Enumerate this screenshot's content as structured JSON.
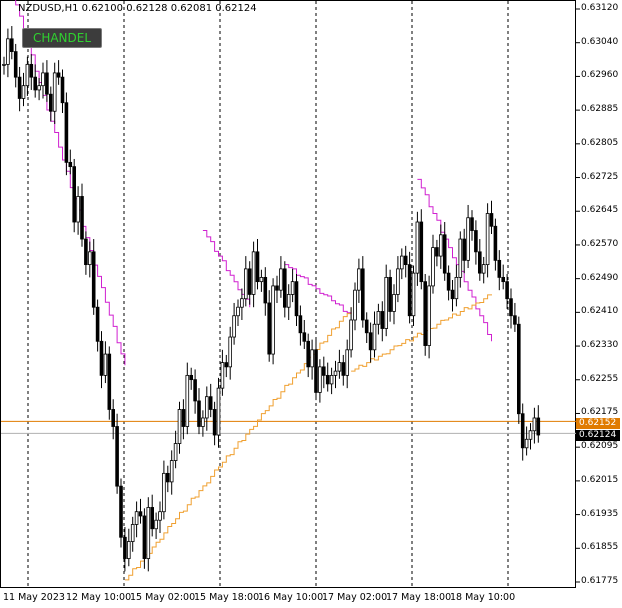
{
  "header": {
    "symbol": "NZDUSD,H1",
    "quote": "0.62100 0.62128 0.62081 0.62124"
  },
  "indicator_button": {
    "label": "CHANDEL",
    "text_color": "#2fd12f"
  },
  "colors": {
    "candle": "#000000",
    "stop_upper": "#d020d0",
    "stop_lower": "#f0a030",
    "line_orange": "#e07b00",
    "line_grey": "#b0b0b0"
  },
  "price_tags": {
    "orange": "0.62152",
    "current": "0.62124"
  },
  "y_axis": {
    "ticks": [
      "0.63120",
      "0.63040",
      "0.62960",
      "0.62885",
      "0.62805",
      "0.62725",
      "0.62645",
      "0.62570",
      "0.62490",
      "0.62410",
      "0.62330",
      "0.62255",
      "0.62175",
      "0.62095",
      "0.62015",
      "0.61935",
      "0.61855",
      "0.61775"
    ]
  },
  "x_axis": {
    "labels": [
      "11 May 2023",
      "12 May 10:00",
      "15 May 02:00",
      "15 May 18:00",
      "16 May 10:00",
      "17 May 02:00",
      "17 May 18:00",
      "18 May 10:00"
    ]
  },
  "chart_data": {
    "type": "candlestick",
    "title": "NZDUSD,H1",
    "ylim": [
      0.61775,
      0.6312
    ],
    "horizontal_lines": [
      {
        "value": 0.62152,
        "color": "#e07b00"
      },
      {
        "value": 0.62124,
        "color": "#b0b0b0"
      }
    ],
    "closes": [
      0.6299,
      0.6305,
      0.6302,
      0.6296,
      0.6291,
      0.6294,
      0.6299,
      0.6296,
      0.6293,
      0.6294,
      0.6297,
      0.6292,
      0.6288,
      0.6297,
      0.6296,
      0.629,
      0.6276,
      0.6275,
      0.6262,
      0.6268,
      0.6258,
      0.6252,
      0.6255,
      0.6242,
      0.6234,
      0.6226,
      0.6231,
      0.6218,
      0.6214,
      0.62,
      0.6188,
      0.6183,
      0.6187,
      0.6191,
      0.6194,
      0.6193,
      0.6183,
      0.6195,
      0.619,
      0.6192,
      0.6194,
      0.6203,
      0.6201,
      0.6206,
      0.621,
      0.6218,
      0.6214,
      0.6226,
      0.6225,
      0.622,
      0.6214,
      0.6216,
      0.6221,
      0.6218,
      0.6212,
      0.6223,
      0.6229,
      0.6228,
      0.6235,
      0.624,
      0.6242,
      0.6244,
      0.6251,
      0.6245,
      0.6255,
      0.6248,
      0.6249,
      0.6243,
      0.6231,
      0.6247,
      0.6246,
      0.6251,
      0.6242,
      0.6245,
      0.6248,
      0.624,
      0.6236,
      0.6234,
      0.6228,
      0.6232,
      0.6222,
      0.6228,
      0.6226,
      0.6224,
      0.6226,
      0.6227,
      0.6229,
      0.6226,
      0.6232,
      0.6239,
      0.6246,
      0.6251,
      0.6239,
      0.6236,
      0.6232,
      0.6238,
      0.6241,
      0.6237,
      0.6249,
      0.6241,
      0.6245,
      0.6251,
      0.6254,
      0.6252,
      0.624,
      0.625,
      0.6262,
      0.6248,
      0.6233,
      0.6247,
      0.6256,
      0.6254,
      0.6259,
      0.625,
      0.6246,
      0.6244,
      0.6249,
      0.6258,
      0.6253,
      0.6263,
      0.626,
      0.6255,
      0.625,
      0.6252,
      0.6264,
      0.6261,
      0.6253,
      0.6249,
      0.6248,
      0.6244,
      0.624,
      0.6238,
      0.6217,
      0.6209,
      0.6211,
      0.6213,
      0.6216,
      0.6212
    ],
    "upper_stop": {
      "name": "",
      "segments": [
        [
          2,
          31,
          0.6316,
          0.6228
        ],
        [
          51,
          63,
          0.626,
          0.6242
        ],
        [
          72,
          89,
          0.6252,
          0.624
        ],
        [
          106,
          125,
          0.6272,
          0.6234
        ]
      ]
    },
    "lower_stop": {
      "name": "",
      "segments": [
        [
          31,
          89,
          0.6178,
          0.6242
        ],
        [
          89,
          125,
          0.6227,
          0.6245
        ]
      ]
    }
  }
}
